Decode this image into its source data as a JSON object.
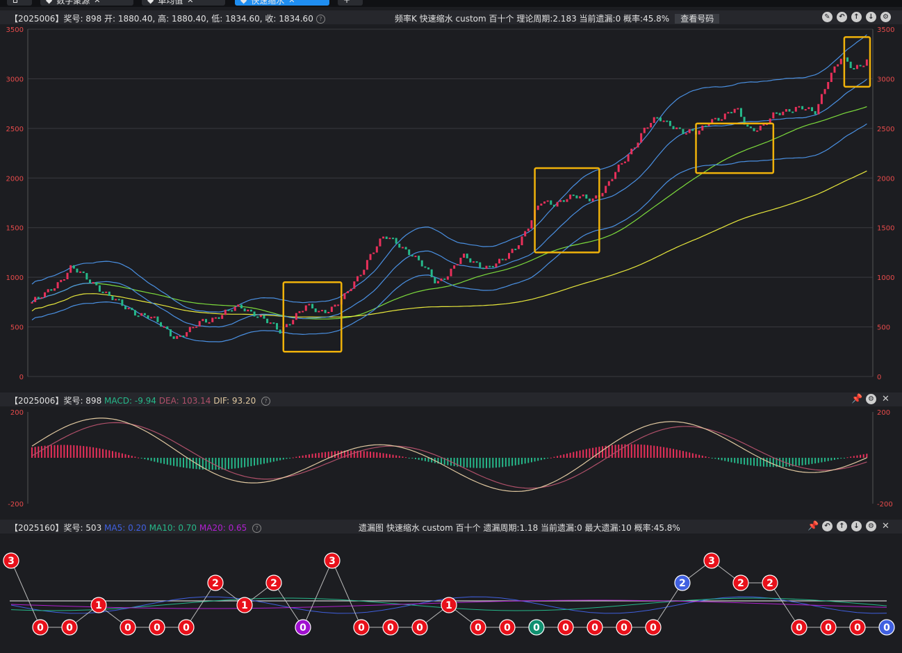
{
  "tabs": [
    {
      "label": "",
      "icon": "home-icon"
    },
    {
      "label": "数字聚源"
    },
    {
      "label": "单均值"
    },
    {
      "label": "快速缩水",
      "active": true
    },
    {
      "label": "+"
    }
  ],
  "kline": {
    "info": "【2025006】奖号: 898  开: 1880.40, 高: 1880.40, 低: 1834.60, 收: 1834.60",
    "mode": "频率K  快速缩水  custom  百十个  理论周期:2.183  当前遗漏:0  概率:45.8%",
    "query_label": "查看号码",
    "y_ticks": [
      "3500",
      "3000",
      "2500",
      "2000",
      "1500",
      "1000",
      "500",
      "0"
    ],
    "colors": {
      "up": "#e8305a",
      "down": "#26b88a",
      "upper": "#4a90e2",
      "lower": "#4a90e2",
      "ma_green": "#7ddc3c",
      "ma_yellow": "#e8e83c",
      "box": "#f0b20a"
    }
  },
  "macd": {
    "prefix": "【2025006】奖号: 898",
    "macd_label": "MACD: -9.94",
    "dea_label": "DEA: 103.14",
    "dif_label": "DIF: 93.20",
    "y_ticks": [
      "200",
      "-200"
    ],
    "colors": {
      "macd": "#26b88a",
      "dea": "#b0506a",
      "dif": "#e0c8a0"
    }
  },
  "omit": {
    "prefix": "【2025160】奖号: 503",
    "ma5_label": "MA5: 0.20",
    "ma10_label": "MA10: 0.70",
    "ma20_label": "MA20: 0.65",
    "mode": "遗漏图  快速缩水  custom  百十个  遗漏周期:1.18  当前遗漏:0  最大遗漏:10  概率:45.8%",
    "values": [
      3,
      0,
      0,
      1,
      0,
      0,
      0,
      2,
      1,
      2,
      0,
      3,
      0,
      0,
      0,
      1,
      0,
      0,
      0,
      0,
      0,
      0,
      0,
      2,
      3,
      2,
      2,
      0,
      0,
      0,
      0
    ],
    "colors": {
      "red": "#e8101a",
      "blue": "#4060e0",
      "purple": "#a010d0",
      "teal": "#109070",
      "ma5": "#4060e0",
      "ma10": "#26b88a",
      "ma20": "#b020d0"
    }
  },
  "chart_data": [
    {
      "type": "candlestick",
      "title": "频率K",
      "ylim": [
        0,
        3500
      ],
      "y_ticks": [
        0,
        500,
        1000,
        1500,
        2000,
        2500,
        3000,
        3500
      ],
      "series": [
        {
          "values": [
            750,
            820,
            950,
            1100,
            1000,
            920,
            800,
            700,
            650,
            600,
            500,
            400,
            450,
            550,
            600,
            650,
            700,
            650,
            550,
            450,
            600,
            700,
            650,
            700,
            800,
            1000,
            1250,
            1400,
            1350,
            1250,
            1100,
            950,
            1050,
            1200,
            1150,
            1100,
            1150,
            1300,
            1500,
            1750,
            1750,
            1800,
            1800,
            1800,
            1900,
            2100,
            2300,
            2500,
            2600,
            2550,
            2450,
            2450,
            2600,
            2600,
            2700,
            2500,
            2500,
            2650,
            2700,
            2700,
            2650,
            3000,
            3200,
            3100,
            3200
          ]
        }
      ]
    },
    {
      "type": "line",
      "title": "MACD",
      "ylim": [
        -200,
        200
      ],
      "y_ticks": [
        -200,
        200
      ]
    },
    {
      "type": "scatter",
      "title": "遗漏图"
    }
  ]
}
